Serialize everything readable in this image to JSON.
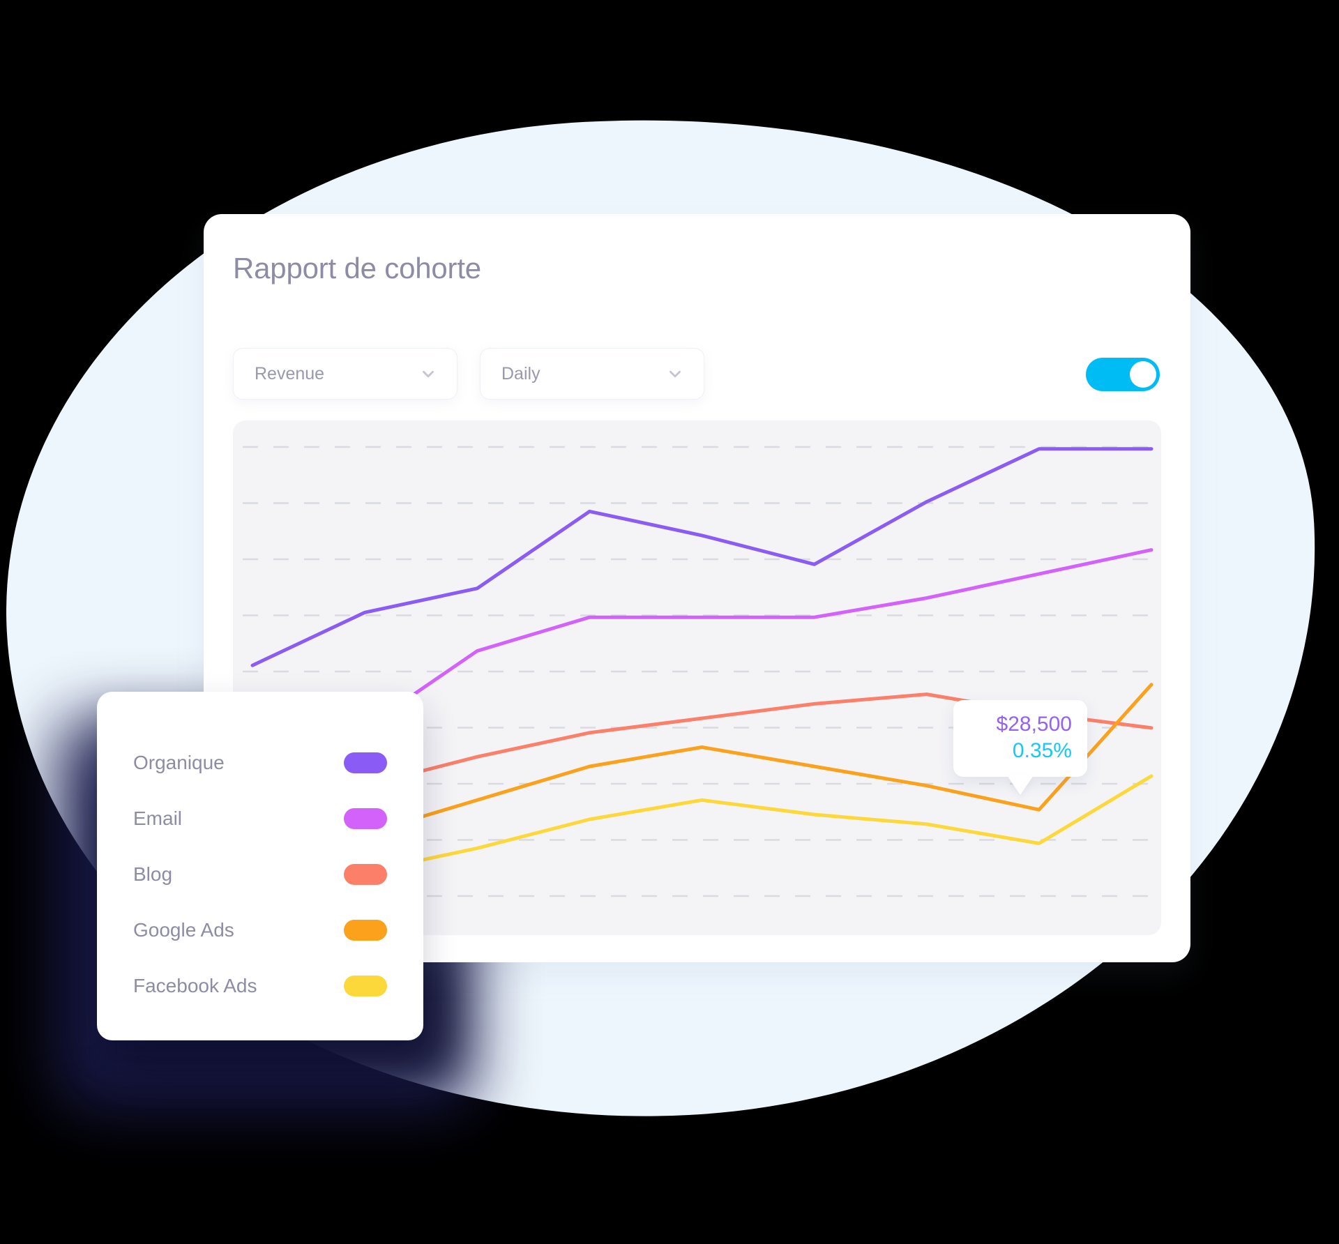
{
  "card": {
    "title": "Rapport de cohorte"
  },
  "controls": {
    "metric_select": {
      "value": "Revenue",
      "icon": "chevron-down-icon"
    },
    "period_select": {
      "value": "Daily",
      "icon": "chevron-down-icon"
    },
    "toggle": {
      "state": "on",
      "color": "#00bcf4"
    }
  },
  "tooltip": {
    "value": "$28,500",
    "percent": "0.35%",
    "value_color": "#9461f0",
    "percent_color": "#14c8f8"
  },
  "legend": {
    "items": [
      {
        "label": "Organique",
        "color": "#8a5cf5"
      },
      {
        "label": "Email",
        "color": "#d362fb"
      },
      {
        "label": "Blog",
        "color": "#fb7f69"
      },
      {
        "label": "Google Ads",
        "color": "#fba11c"
      },
      {
        "label": "Facebook Ads",
        "color": "#fdd83b"
      }
    ]
  },
  "colors": {
    "page_background": "#000000",
    "blob": "#eef6fd",
    "card": "#ffffff",
    "plot_background": "#f4f4f7",
    "gridline": "#d9dae2",
    "title_text": "#8e8ca4",
    "legend_shadow": "#1b1c4e"
  },
  "chart_data": {
    "type": "line",
    "title": "Rapport de cohorte",
    "xlabel": "",
    "ylabel": "Revenue",
    "grid": true,
    "gridlines": 9,
    "legend_position": "external-left",
    "x": [
      0,
      1,
      2,
      3,
      4,
      5,
      6,
      7,
      8
    ],
    "xlim": [
      0,
      8
    ],
    "ylim": [
      0,
      100
    ],
    "series": [
      {
        "name": "Organique",
        "color": "#8a5cf5",
        "values": [
          52,
          63,
          68,
          84,
          79,
          73,
          86,
          97,
          97
        ]
      },
      {
        "name": "Email",
        "color": "#d362fb",
        "values": [
          39,
          39,
          55,
          62,
          62,
          62,
          66,
          71,
          76
        ]
      },
      {
        "name": "Blog",
        "color": "#fb7f69",
        "values": [
          27,
          27,
          33,
          38,
          41,
          44,
          46,
          42,
          39
        ]
      },
      {
        "name": "Google Ads",
        "color": "#fba11c",
        "values": [
          17,
          17,
          24,
          31,
          35,
          31,
          27,
          22,
          48
        ]
      },
      {
        "name": "Facebook Ads",
        "color": "#fdd83b",
        "values": [
          9,
          9,
          14,
          20,
          24,
          21,
          19,
          15,
          29
        ]
      }
    ],
    "annotation": {
      "series": "Organique",
      "x": 5,
      "label_value": "$28,500",
      "label_percent": "0.35%"
    }
  }
}
